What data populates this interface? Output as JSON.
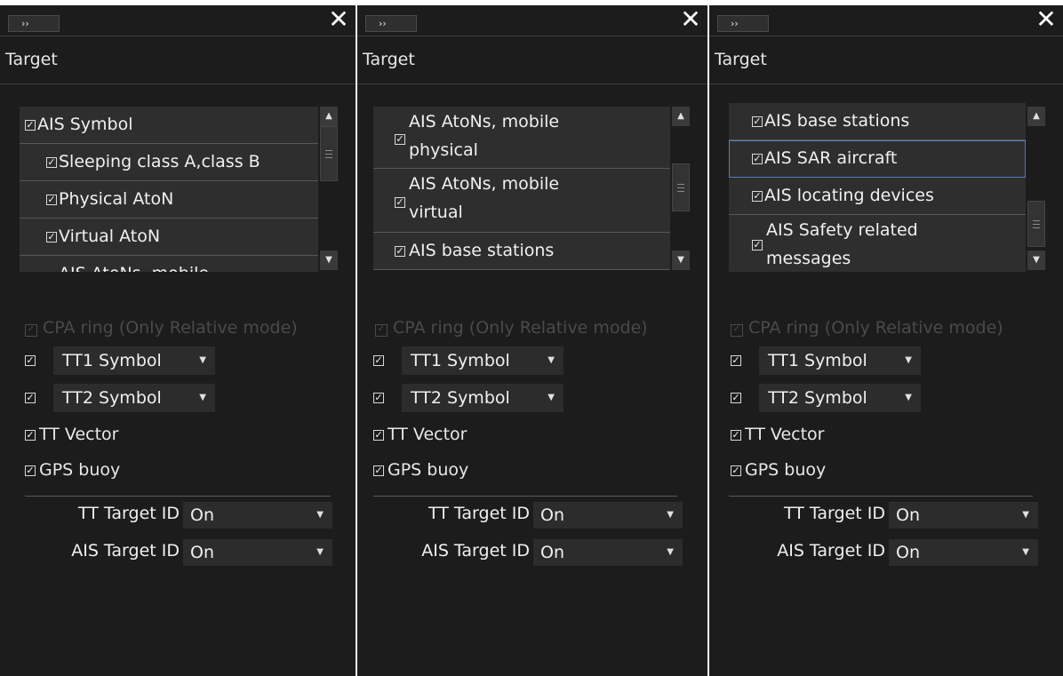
{
  "panels": [
    {
      "expand_icon": "double-chevron-right-icon",
      "expand_glyph": "››",
      "close_glyph": "✕",
      "title": "Target",
      "list": [
        {
          "label": "AIS Symbol",
          "checked": true
        },
        {
          "label": "Sleeping class A,class B",
          "checked": true
        },
        {
          "label": "Physical AtoN",
          "checked": true
        },
        {
          "label": "Virtual AtoN",
          "checked": true
        },
        {
          "label": "AIS AtoNs, mobile",
          "checked": false
        }
      ],
      "scroll_up": "▲",
      "scroll_down": "▼",
      "cpa_label": "CPA ring (Only Relative mode)",
      "tt1_label": "TT1 Symbol",
      "tt2_label": "TT2 Symbol",
      "tt_vector_label": "TT Vector",
      "gps_buoy_label": "GPS buoy",
      "tt_target_id_label": "TT Target ID",
      "tt_target_id_value": "On",
      "ais_target_id_label": "AIS Target ID",
      "ais_target_id_value": "On"
    },
    {
      "expand_icon": "double-chevron-right-icon",
      "expand_glyph": "››",
      "close_glyph": "✕",
      "title": "Target",
      "list": [
        {
          "label": "AIS AtoNs, mobile",
          "label2": "physical",
          "checked": true
        },
        {
          "label": "AIS AtoNs, mobile",
          "label2": "virtual",
          "checked": true
        },
        {
          "label": "AIS base stations",
          "checked": true
        }
      ],
      "scroll_up": "▲",
      "scroll_down": "▼",
      "cpa_label": "CPA ring (Only Relative mode)",
      "tt1_label": "TT1 Symbol",
      "tt2_label": "TT2 Symbol",
      "tt_vector_label": "TT Vector",
      "gps_buoy_label": "GPS buoy",
      "tt_target_id_label": "TT Target ID",
      "tt_target_id_value": "On",
      "ais_target_id_label": "AIS Target ID",
      "ais_target_id_value": "On"
    },
    {
      "expand_icon": "double-chevron-right-icon",
      "expand_glyph": "››",
      "close_glyph": "✕",
      "title": "Target",
      "list": [
        {
          "label": "AIS base stations",
          "checked": true
        },
        {
          "label": "AIS SAR aircraft",
          "checked": true
        },
        {
          "label": "AIS locating devices",
          "checked": true
        },
        {
          "label": "AIS Safety related",
          "label2": "messages",
          "checked": true
        }
      ],
      "scroll_up": "▲",
      "scroll_down": "▼",
      "cpa_label": "CPA ring (Only Relative mode)",
      "tt1_label": "TT1 Symbol",
      "tt2_label": "TT2 Symbol",
      "tt_vector_label": "TT Vector",
      "gps_buoy_label": "GPS buoy",
      "tt_target_id_label": "TT Target ID",
      "tt_target_id_value": "On",
      "ais_target_id_label": "AIS Target ID",
      "ais_target_id_value": "On"
    }
  ],
  "check_glyph": "✓",
  "dropdown_arrow": "▼",
  "colors": {
    "panel_bg": "#1c1c1c",
    "item_bg": "#2e2e2e",
    "selected_outline": "#4a7fc1",
    "disabled_text": "#4a4a4a"
  }
}
